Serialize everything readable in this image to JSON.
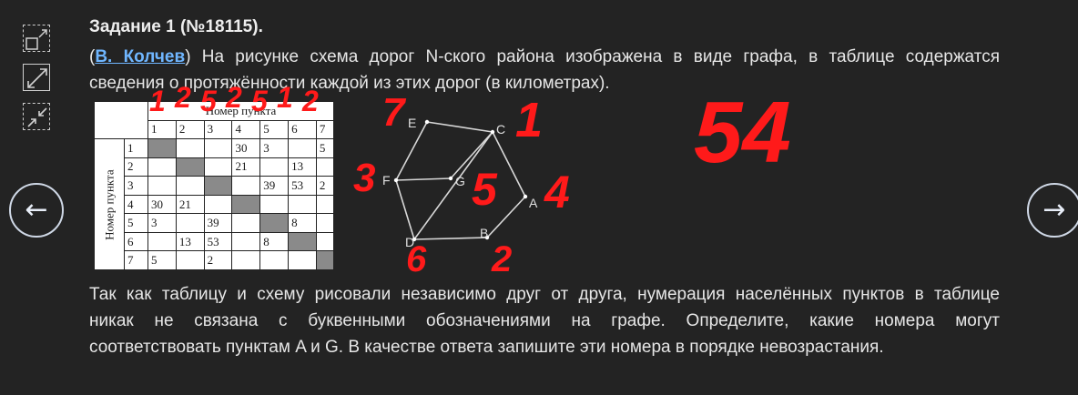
{
  "tools": {
    "icons": [
      "collapse-expand-icon",
      "expand-arrows-icon",
      "shrink-arrows-icon"
    ]
  },
  "nav": {
    "prev": "←",
    "next": "→"
  },
  "task": {
    "title": "Задание 1 (№18115).",
    "open_paren": "(",
    "author": "В. Колчев",
    "intro_rest": ") На рисунке схема дорог N-ского района изображена в виде графа, в таблице содержатся",
    "intro_line2": "сведения о протяжённости каждой из этих дорог (в километрах).",
    "question_lines": [
      "Так как таблицу и схему рисовали независимо друг от друга, нумерация населённых пунктов в таблице",
      "никак не связана с буквенными обозначениями на графе. Определите, какие номера могут",
      "соответствовать пунктам A и G. В качестве ответа запишите эти номера в порядке невозрастания."
    ]
  },
  "table": {
    "header": "Номер пункта",
    "row_header": "Номер пункта",
    "cols": [
      "1",
      "2",
      "3",
      "4",
      "5",
      "6",
      "7"
    ],
    "rows": [
      {
        "n": "1",
        "cells": [
          "",
          "",
          "",
          "30",
          "3",
          "",
          "5"
        ]
      },
      {
        "n": "2",
        "cells": [
          "",
          "",
          "",
          "21",
          "",
          "13",
          ""
        ]
      },
      {
        "n": "3",
        "cells": [
          "",
          "",
          "",
          "",
          "39",
          "53",
          "2"
        ]
      },
      {
        "n": "4",
        "cells": [
          "30",
          "21",
          "",
          "",
          "",
          "",
          ""
        ]
      },
      {
        "n": "5",
        "cells": [
          "3",
          "",
          "39",
          "",
          "",
          "8",
          ""
        ]
      },
      {
        "n": "6",
        "cells": [
          "",
          "13",
          "53",
          "",
          "8",
          "",
          ""
        ]
      },
      {
        "n": "7",
        "cells": [
          "5",
          "",
          "2",
          "",
          "",
          "",
          ""
        ]
      }
    ]
  },
  "graph": {
    "labels": {
      "E": "E",
      "C": "C",
      "F": "F",
      "G": "G",
      "A": "A",
      "B": "B",
      "D": "D"
    }
  },
  "annotations": {
    "over_columns": [
      "1",
      "2",
      "5",
      "2",
      "5",
      "1",
      "2"
    ],
    "E": "7",
    "C": "1",
    "F": "3",
    "G": "5",
    "A": "4",
    "D": "6",
    "B": "2",
    "answer": "54"
  }
}
